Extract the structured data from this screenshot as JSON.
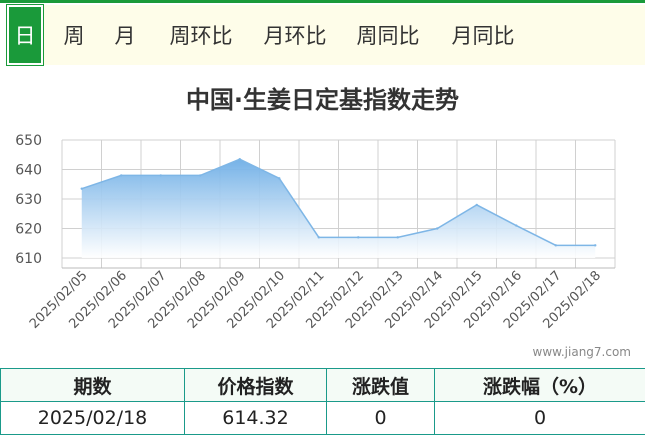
{
  "tabs": [
    {
      "label": "日",
      "active": true
    },
    {
      "label": "周",
      "active": false
    },
    {
      "label": "月",
      "active": false
    },
    {
      "label": "周环比",
      "active": false
    },
    {
      "label": "月环比",
      "active": false
    },
    {
      "label": "周同比",
      "active": false
    },
    {
      "label": "月同比",
      "active": false
    }
  ],
  "watermark": "www.jiang7.com",
  "table": {
    "headers": [
      "期数",
      "价格指数",
      "涨跌值",
      "涨跌幅（%）"
    ],
    "row": [
      "2025/02/18",
      "614.32",
      "0",
      "0"
    ]
  },
  "colors": {
    "accent": "#1a9a3a",
    "series": "#7eb6e6",
    "grid": "#d0d0d0"
  },
  "chart_data": {
    "type": "area",
    "title": "中国·生姜日定基指数走势",
    "xlabel": "",
    "ylabel": "",
    "ylim": [
      610,
      650
    ],
    "yticks": [
      610,
      620,
      630,
      640,
      650
    ],
    "categories": [
      "2025/02/05",
      "2025/02/06",
      "2025/02/07",
      "2025/02/08",
      "2025/02/09",
      "2025/02/10",
      "2025/02/11",
      "2025/02/12",
      "2025/02/13",
      "2025/02/14",
      "2025/02/15",
      "2025/02/16",
      "2025/02/17",
      "2025/02/18"
    ],
    "series": [
      {
        "values": [
          633.5,
          638,
          638,
          638,
          643.5,
          637,
          617,
          617,
          617,
          620,
          628,
          621,
          614.3,
          614.3
        ]
      }
    ],
    "grid": true,
    "legend": "none"
  }
}
